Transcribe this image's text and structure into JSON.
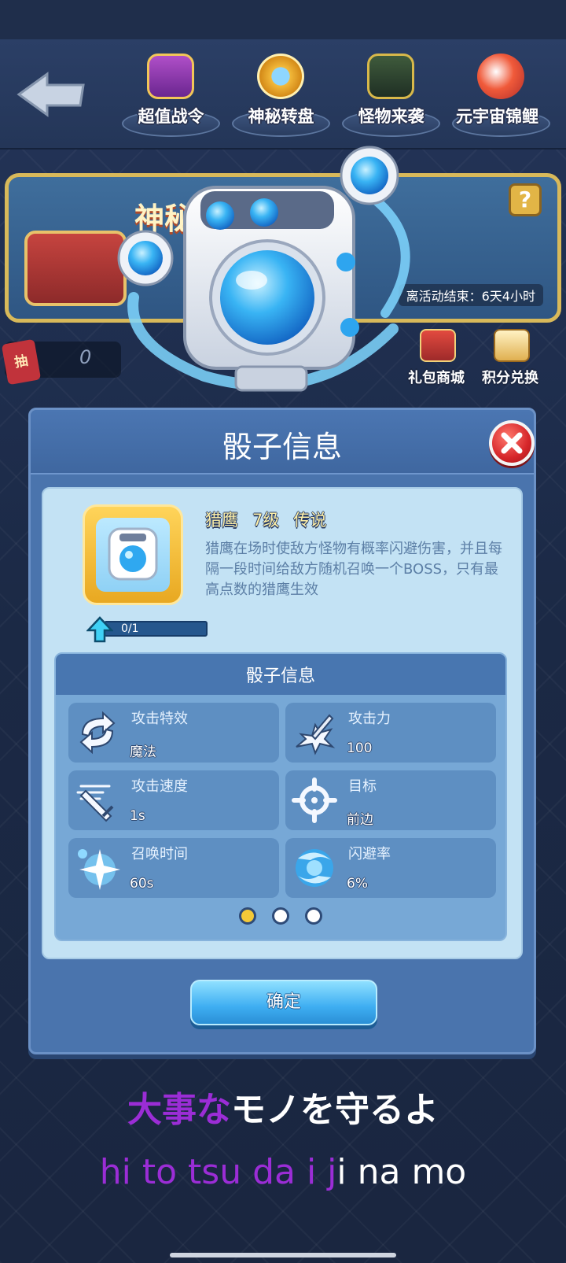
{
  "nav": {
    "items": [
      {
        "label": "超值战令",
        "icon": "battle-pass-icon"
      },
      {
        "label": "神秘转盘",
        "icon": "mystery-wheel-icon"
      },
      {
        "label": "怪物来袭",
        "icon": "monster-attack-icon"
      },
      {
        "label": "元宇宙锦鲤",
        "icon": "koi-fish-icon"
      }
    ]
  },
  "banner": {
    "title": "神秘",
    "help": "?",
    "timer": "离活动结束：6天4小时"
  },
  "draw": {
    "tag": "抽",
    "count": "0"
  },
  "shortcuts": [
    {
      "label": "礼包商城",
      "icon": "gift-shop-icon"
    },
    {
      "label": "积分兑换",
      "icon": "points-exchange-icon"
    }
  ],
  "dialog": {
    "title": "骰子信息",
    "dice": {
      "name": "猎鹰",
      "level": "7级",
      "rarity": "传说",
      "description": "猎鹰在场时使敌方怪物有概率闪避伤害，并且每隔一段时间给敌方随机召唤一个BOSS，只有最高点数的猎鹰生效",
      "progress_text": "0/1",
      "progress": 0
    },
    "info": {
      "title": "骰子信息",
      "stats": [
        {
          "label": "攻击特效",
          "value": "魔法",
          "icon": "swap-arrows-icon"
        },
        {
          "label": "攻击力",
          "value": "100",
          "icon": "sword-burst-icon"
        },
        {
          "label": "攻击速度",
          "value": "1s",
          "icon": "fast-sword-icon"
        },
        {
          "label": "目标",
          "value": "前边",
          "icon": "crosshair-icon"
        },
        {
          "label": "召唤时间",
          "value": "60s",
          "icon": "sparkle-icon"
        },
        {
          "label": "闪避率",
          "value": "6%",
          "icon": "dodge-swirl-icon"
        }
      ],
      "page": 1,
      "page_count": 3
    },
    "confirm": "确定"
  },
  "lyrics": {
    "line1_sung": "大事な",
    "line1_rest": "なモノを守るよ",
    "line2_sung": "hi to tsu   da i j",
    "line2_rest": "i na mo"
  },
  "colors": {
    "lyric_highlight": "#9b2dd6",
    "rarity_text": "#fff1a8",
    "confirm": "#3eaef2",
    "close": "#d6262a"
  }
}
